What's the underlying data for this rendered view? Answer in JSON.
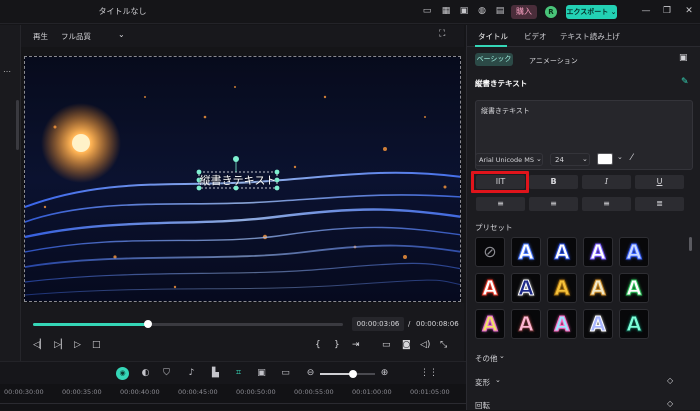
{
  "window": {
    "title": "タイトルなし"
  },
  "header": {
    "buy_label": "購入",
    "avatar_initial": "R",
    "export_label": "エクスポート ⌄"
  },
  "preview": {
    "play_label": "再生",
    "quality_label": "フル品質"
  },
  "overlay": {
    "text": "縦書きテキスト"
  },
  "player": {
    "current_time": "00:00:03:06",
    "separator": "/",
    "total_time": "00:00:08:06",
    "progress": 0.37
  },
  "panel": {
    "tabs": [
      "タイトル",
      "ビデオ",
      "テキスト読み上げ"
    ],
    "subtabs": [
      "ベーシック",
      "アニメーション"
    ],
    "section_title": "縦書きテキスト",
    "text_value": "縦書きテキスト",
    "font_name": "Arial Unicode MS",
    "font_size": "24",
    "text_color": "#ffffff",
    "format_buttons": [
      "IIT",
      "B",
      "I",
      "U"
    ],
    "highlight_color": "#e0141b",
    "preset_label": "プリセット",
    "presets": [
      {
        "letter": "A",
        "fill": "#ffffff",
        "outline": "#4d7cff"
      },
      {
        "letter": "A",
        "fill": "#ffffff",
        "outline": "#2a4dd8"
      },
      {
        "letter": "A",
        "fill": "#ffffff",
        "outline": "#7a5cff"
      },
      {
        "letter": "A",
        "fill": "#c9d8ff",
        "outline": "#3a62ff"
      },
      {
        "letter": "A",
        "fill": "#ffffff",
        "outline": "#e53b2c"
      },
      {
        "letter": "A",
        "fill": "#1e2a8a",
        "outline": "#ffffff"
      },
      {
        "letter": "A",
        "fill": "#f6c23a",
        "outline": "#9c6a10"
      },
      {
        "letter": "A",
        "fill": "#f3e9c8",
        "outline": "#c98b2b"
      },
      {
        "letter": "A",
        "fill": "#ffffff",
        "outline": "#2fbf5a"
      },
      {
        "letter": "A",
        "fill": "#f2e06b",
        "outline": "#e56bd0"
      },
      {
        "letter": "A",
        "fill": "#ffb7d2",
        "outline": "#5a2a2a"
      },
      {
        "letter": "A",
        "fill": "#9fe4ff",
        "outline": "#ff6ac1"
      },
      {
        "letter": "A",
        "fill": "#a8b6ff",
        "outline": "#ffffff"
      },
      {
        "letter": "A",
        "fill": "#7dffd9",
        "outline": "#0a4a3d"
      }
    ],
    "other_label": "その他",
    "transform_label": "変形",
    "composite_label": "回転"
  },
  "timeline": {
    "ticks": [
      "00:00:30:00",
      "00:00:35:00",
      "00:00:40:00",
      "00:00:45:00",
      "00:00:50:00",
      "00:00:55:00",
      "00:01:00:00",
      "00:01:05:00"
    ],
    "zoom_level": 0.6
  },
  "icons": [
    "monitor-icon",
    "grid-icon",
    "picture-icon",
    "headset-icon",
    "minimize-icon",
    "maximize-icon",
    "close-icon",
    "play-icon",
    "pause-icon",
    "stop-icon",
    "camera-icon",
    "volume-icon",
    "fullscreen-icon",
    "zoom-out-icon",
    "zoom-in-icon",
    "copy-icon",
    "eyedropper-icon"
  ]
}
